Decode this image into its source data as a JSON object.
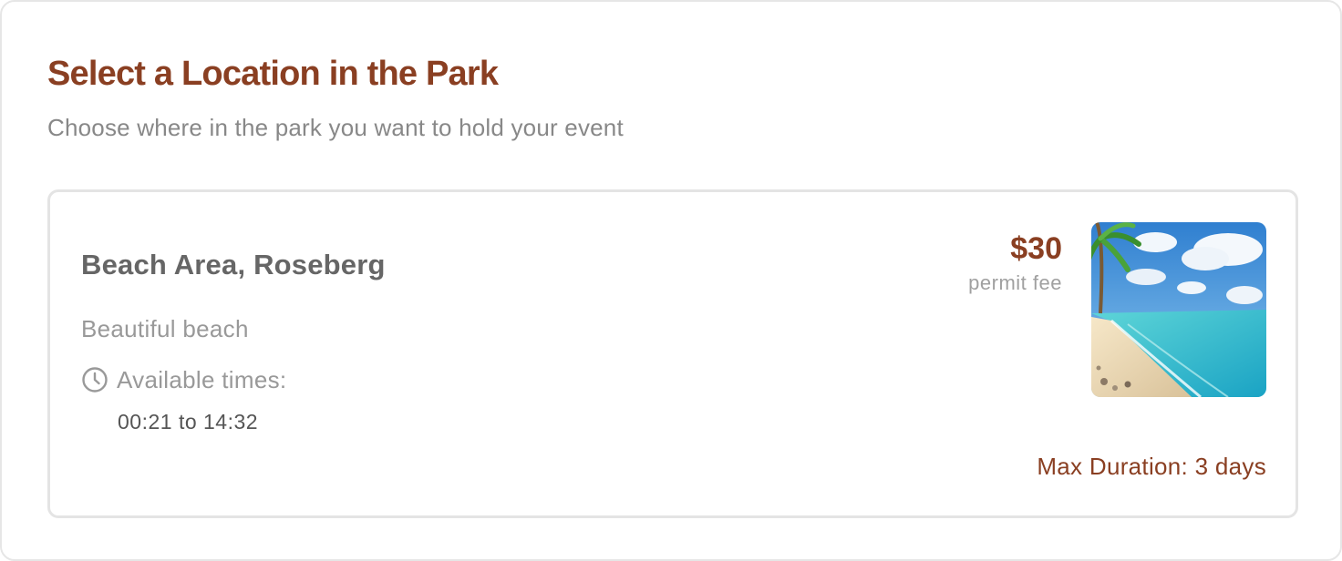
{
  "header": {
    "title": "Select a Location in the Park",
    "subtitle": "Choose where in the park you want to hold your event"
  },
  "location": {
    "name": "Beach Area, Roseberg",
    "description": "Beautiful beach",
    "available_times_label": "Available times:",
    "available_times": "00:21 to 14:32",
    "fee": "$30",
    "fee_label": "permit fee",
    "max_duration": "Max Duration: 3 days",
    "image_icon": "beach-photo"
  },
  "colors": {
    "accent": "#8a3f22",
    "muted_text": "#999999",
    "heading_text": "#666666",
    "border": "#e4e4e4"
  }
}
